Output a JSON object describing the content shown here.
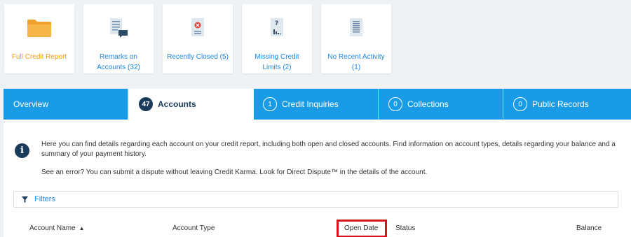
{
  "cards": [
    {
      "label": "Full Credit Report",
      "icon": "folder-icon"
    },
    {
      "label": "Remarks on Accounts (32)",
      "icon": "document-comment-icon"
    },
    {
      "label": "Recently Closed (5)",
      "icon": "document-closed-icon"
    },
    {
      "label": "Missing Credit Limits (2)",
      "icon": "document-question-icon"
    },
    {
      "label": "No Recent Activity (1)",
      "icon": "document-lines-icon"
    }
  ],
  "tabs": [
    {
      "label": "Overview",
      "badge": ""
    },
    {
      "label": "Accounts",
      "badge": "47"
    },
    {
      "label": "Credit Inquiries",
      "badge": "1"
    },
    {
      "label": "Collections",
      "badge": "0"
    },
    {
      "label": "Public Records",
      "badge": "0"
    }
  ],
  "info": {
    "paragraph1": "Here you can find details regarding each account on your credit report, including both open and closed accounts. Find information on account types, details regarding your balance and a summary of your payment history.",
    "paragraph2": "See an error? You can submit a dispute without leaving Credit Karma. Look for Direct Dispute™ in the details of the account."
  },
  "filters": {
    "label": "Filters"
  },
  "columns": {
    "account_name": "Account Name",
    "account_type": "Account Type",
    "open_date": "Open Date",
    "status": "Status",
    "balance": "Balance"
  },
  "colors": {
    "tab_bar": "#1a9be6",
    "navy": "#1a3b5c",
    "link_blue": "#1e88e5",
    "active_card": "#f39c12",
    "highlight": "#d8131a"
  }
}
